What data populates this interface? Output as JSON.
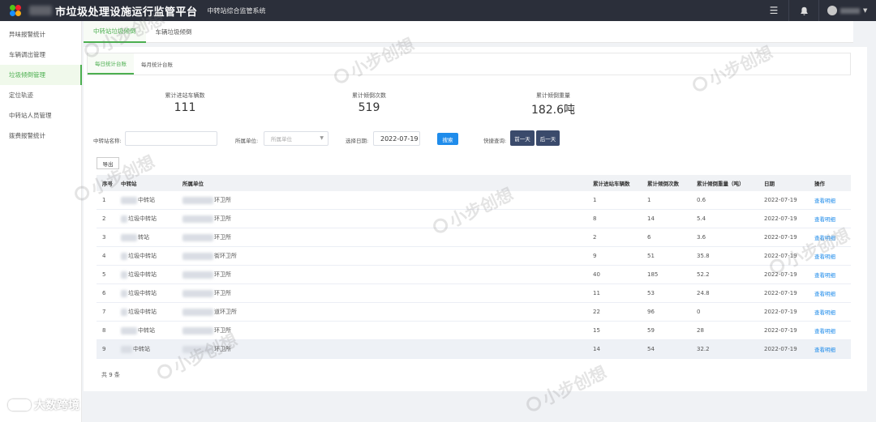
{
  "header": {
    "title": "市垃圾处理设施运行监管平台",
    "subtitle": "中转站综合监管系统"
  },
  "sidebar": {
    "items": [
      {
        "label": "异味报警统计"
      },
      {
        "label": "车辆调出管理"
      },
      {
        "label": "垃圾倾倒管理"
      },
      {
        "label": "定位轨迹"
      },
      {
        "label": "中转站人员管理"
      },
      {
        "label": "拨费报警统计"
      }
    ]
  },
  "tabs": {
    "primary": [
      {
        "label": "中转站垃圾倾倒"
      },
      {
        "label": "车辆垃圾倾倒"
      }
    ],
    "secondary": [
      {
        "label": "每日统计台账"
      },
      {
        "label": "每月统计台账"
      }
    ]
  },
  "stats": [
    {
      "label": "累计进站车辆数",
      "value": "111"
    },
    {
      "label": "累计倾倒次数",
      "value": "519"
    },
    {
      "label": "累计倾倒重量",
      "value": "182.6吨"
    }
  ],
  "filters": {
    "station_label": "中转站名称:",
    "station_value": "",
    "unit_label": "所属单位:",
    "unit_placeholder": "所属单位",
    "date_label": "选择日期:",
    "date_value": "2022-07-19",
    "search_label": "搜索",
    "quick_label": "快捷查询:",
    "prev_label": "前一天",
    "next_label": "后一天",
    "export_label": "导出"
  },
  "table": {
    "columns": [
      "序号",
      "中转站",
      "所属单位",
      "累计进站车辆数",
      "累计倾倒次数",
      "累计倾倒重量（吨）",
      "日期",
      "操作"
    ],
    "rows": [
      {
        "index": "1",
        "station": "中转站",
        "unit": "环卫所",
        "vehicles": "1",
        "dumps": "1",
        "weight": "0.6",
        "date": "2022-07-19",
        "action": "查看明细"
      },
      {
        "index": "2",
        "station": "垃圾中转站",
        "unit": "环卫所",
        "vehicles": "8",
        "dumps": "14",
        "weight": "5.4",
        "date": "2022-07-19",
        "action": "查看明细"
      },
      {
        "index": "3",
        "station": "转站",
        "unit": "环卫所",
        "vehicles": "2",
        "dumps": "6",
        "weight": "3.6",
        "date": "2022-07-19",
        "action": "查看明细"
      },
      {
        "index": "4",
        "station": "垃圾中转站",
        "unit": "街环卫所",
        "vehicles": "9",
        "dumps": "51",
        "weight": "35.8",
        "date": "2022-07-19",
        "action": "查看明细"
      },
      {
        "index": "5",
        "station": "垃圾中转站",
        "unit": "环卫所",
        "vehicles": "40",
        "dumps": "185",
        "weight": "52.2",
        "date": "2022-07-19",
        "action": "查看明细"
      },
      {
        "index": "6",
        "station": "垃圾中转站",
        "unit": "环卫所",
        "vehicles": "11",
        "dumps": "53",
        "weight": "24.8",
        "date": "2022-07-19",
        "action": "查看明细"
      },
      {
        "index": "7",
        "station": "垃圾中转站",
        "unit": "道环卫所",
        "vehicles": "22",
        "dumps": "96",
        "weight": "0",
        "date": "2022-07-19",
        "action": "查看明细"
      },
      {
        "index": "8",
        "station": "中转站",
        "unit": "环卫所",
        "vehicles": "15",
        "dumps": "59",
        "weight": "28",
        "date": "2022-07-19",
        "action": "查看明细"
      },
      {
        "index": "9",
        "station": "中转站",
        "unit": "环卫所",
        "vehicles": "14",
        "dumps": "54",
        "weight": "32.2",
        "date": "2022-07-19",
        "action": "查看明细"
      }
    ],
    "total": "共 9 条"
  },
  "watermark": {
    "text": "小步创想",
    "footer": "大数跨境"
  },
  "colors": {
    "accent": "#4caf50",
    "primary_button": "#1f8ceb",
    "dark_button": "#3a4a6b",
    "topbar": "#2b2f3a"
  },
  "icons": {
    "menu": "hamburger-icon",
    "bell": "bell-icon",
    "user": "avatar-icon"
  }
}
